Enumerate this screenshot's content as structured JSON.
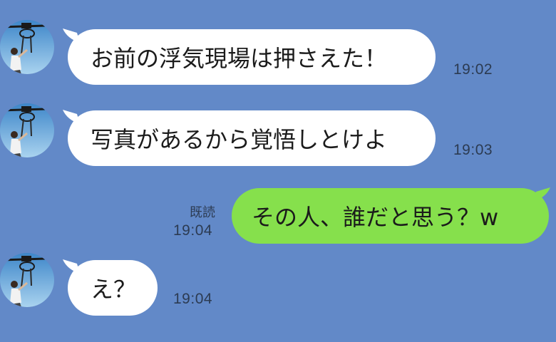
{
  "messages": [
    {
      "side": "left",
      "text": "お前の浮気現場は押さえた！",
      "time": "19:02"
    },
    {
      "side": "left",
      "text": "写真があるから覚悟しとけよ",
      "time": "19:03"
    },
    {
      "side": "right",
      "text": "その人、誰だと思う？w",
      "time": "19:04",
      "read_label": "既読"
    },
    {
      "side": "left",
      "text": "え？",
      "time": "19:04"
    }
  ],
  "colors": {
    "background": "#6289c8",
    "incoming_bubble": "#ffffff",
    "outgoing_bubble": "#86e04c"
  },
  "icons": {
    "avatar": "profile-avatar-icon"
  }
}
